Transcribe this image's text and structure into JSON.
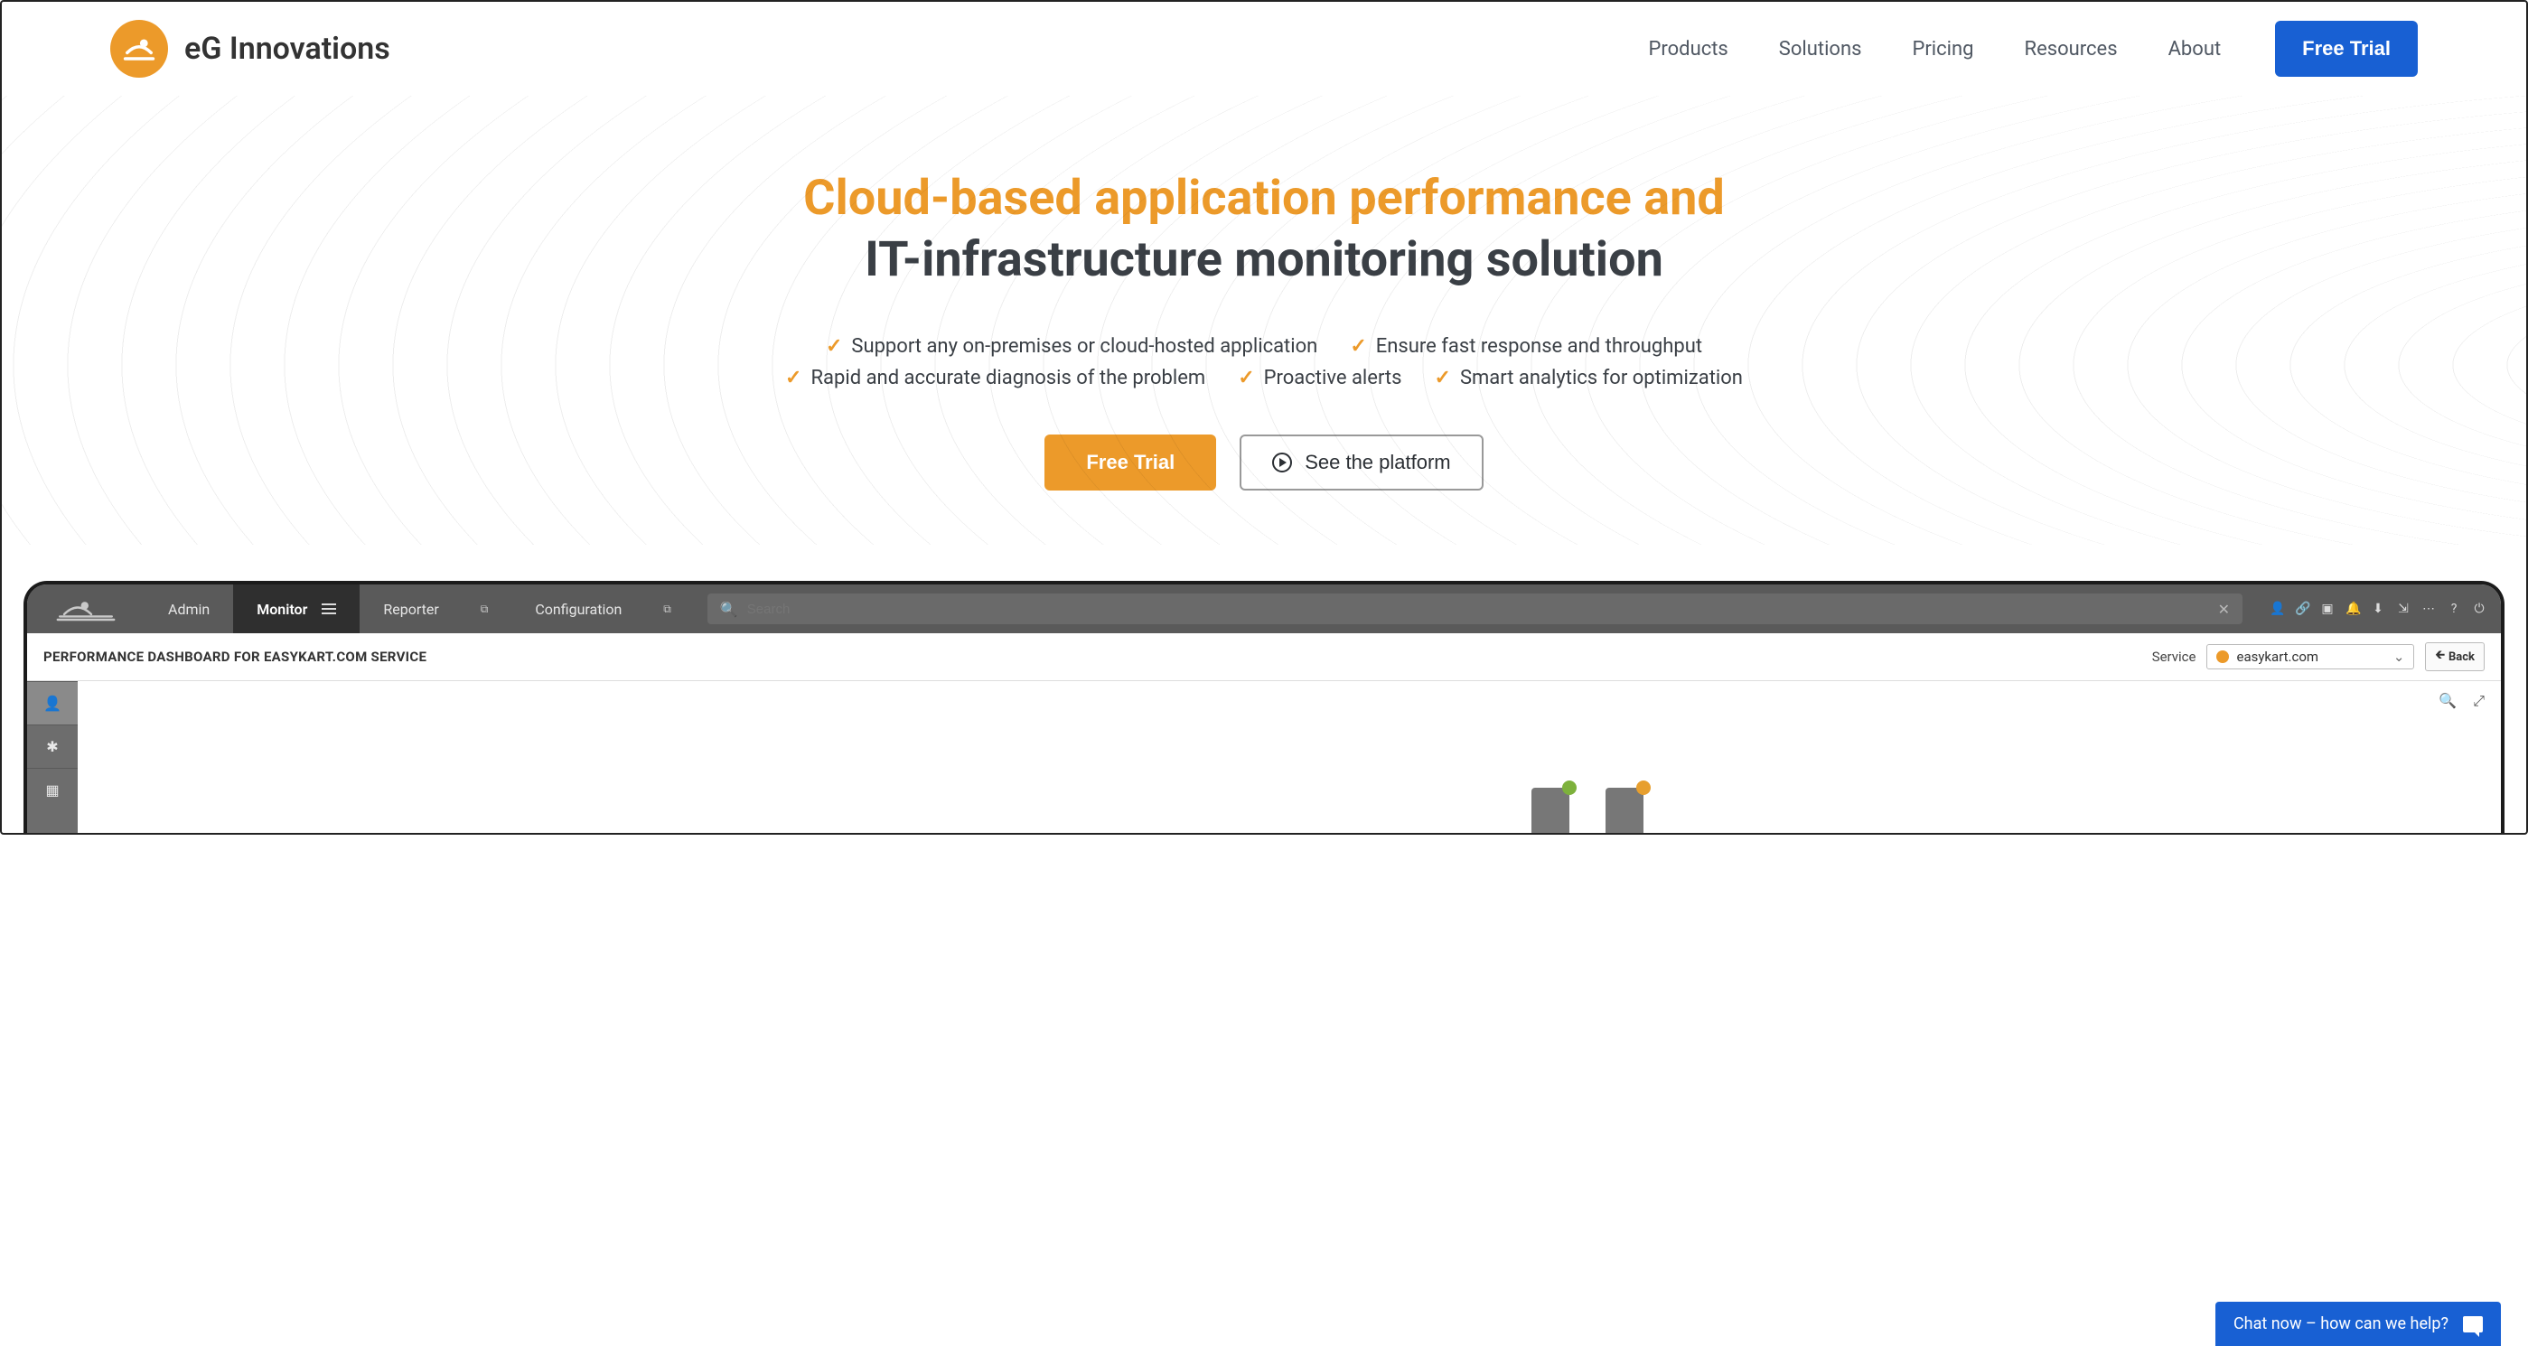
{
  "brand": "eG Innovations",
  "nav": {
    "items": [
      "Products",
      "Solutions",
      "Pricing",
      "Resources",
      "About"
    ],
    "cta": "Free Trial"
  },
  "hero": {
    "title_line1": "Cloud-based application performance and",
    "title_line2": "IT-infrastructure monitoring solution",
    "features": [
      "Support any on-premises or cloud-hosted application",
      "Ensure fast response and throughput",
      "Rapid and accurate diagnosis of the problem",
      "Proactive alerts",
      "Smart analytics for optimization"
    ],
    "cta_primary": "Free Trial",
    "cta_secondary": "See the platform"
  },
  "monitor": {
    "tabs": [
      "Admin",
      "Monitor",
      "Reporter",
      "Configuration"
    ],
    "active_tab": "Monitor",
    "search_placeholder": "Search",
    "dashboard_title": "PERFORMANCE DASHBOARD FOR EASYKART.COM SERVICE",
    "service_label": "Service",
    "service_value": "easykart.com",
    "back_label": "Back",
    "toolbar_icons": [
      "user",
      "link",
      "screen",
      "bell",
      "download",
      "export",
      "more",
      "help",
      "power"
    ]
  },
  "chat": {
    "label": "Chat now – how can we help?"
  },
  "colors": {
    "accent": "#ec9a2a",
    "primary_blue": "#1860d3"
  }
}
